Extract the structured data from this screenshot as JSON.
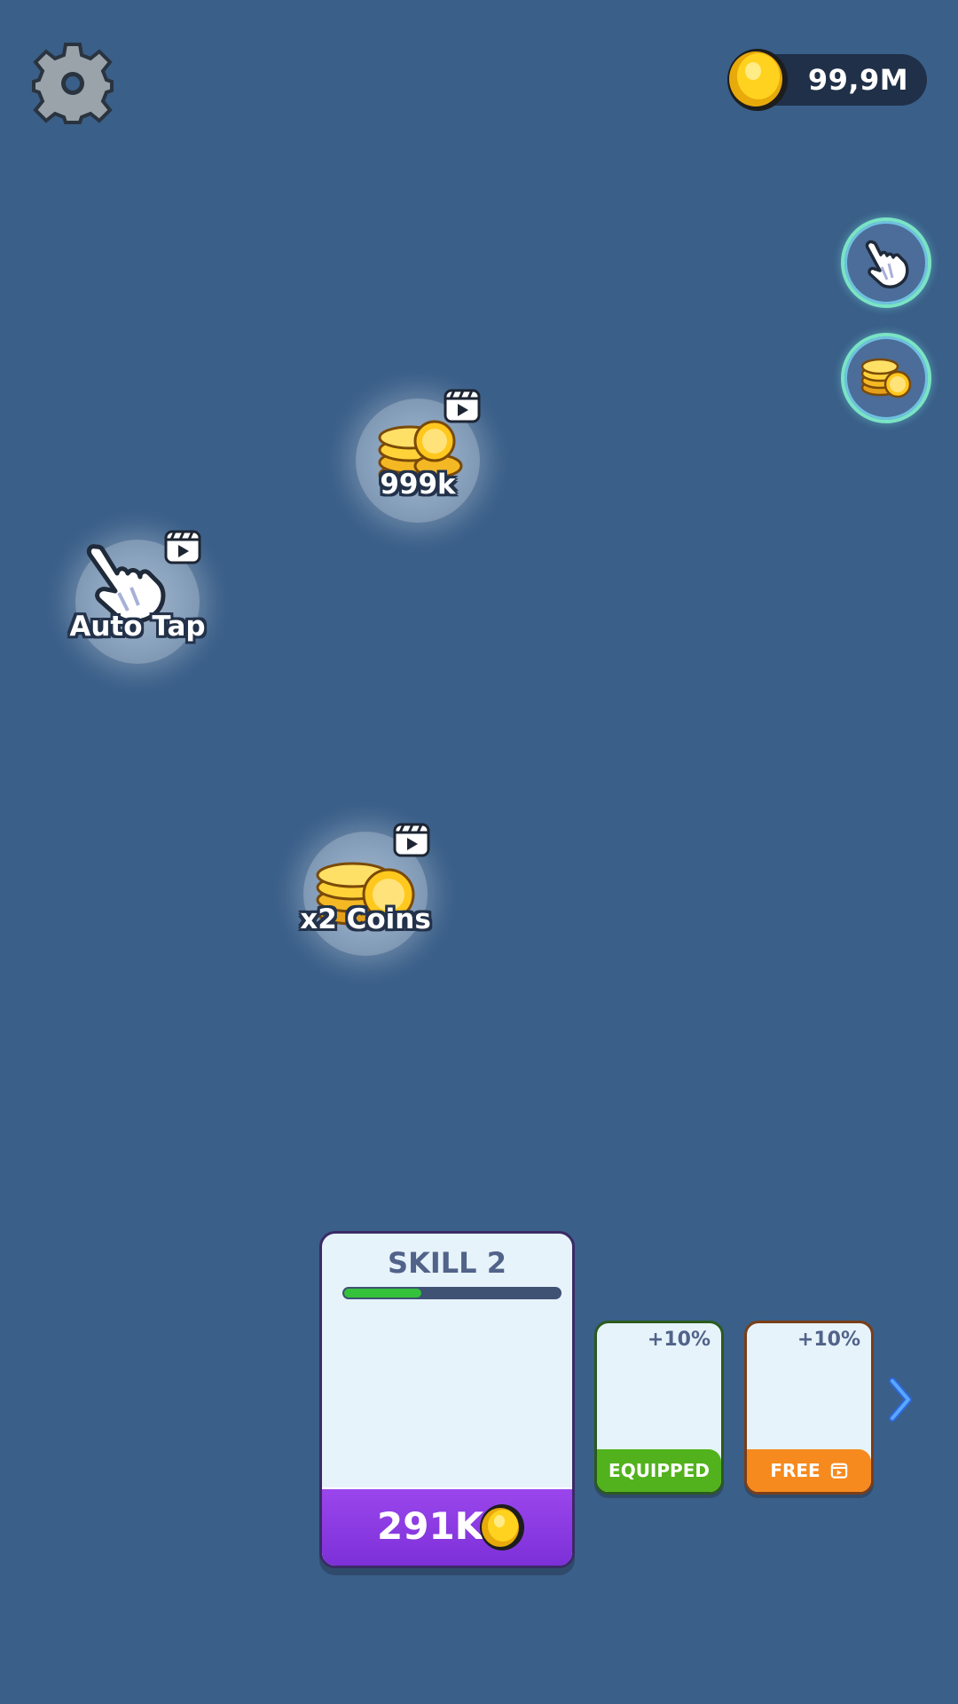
{
  "header": {
    "coins": "99,9M"
  },
  "side_buttons": [
    {
      "icon": "auto-tap-hand-icon"
    },
    {
      "icon": "coin-stack-icon"
    }
  ],
  "bubbles": [
    {
      "label": "999k",
      "icon": "coin-stack-icon"
    },
    {
      "label": "Auto Tap",
      "icon": "tapping-hand-icon"
    },
    {
      "label": "x2 Coins",
      "icon": "coin-stack-icon"
    }
  ],
  "skill_card": {
    "title": "SKILL 2",
    "progress": 0.36,
    "price": "291K"
  },
  "mini_cards": [
    {
      "bonus": "+10%",
      "footer": "EQUIPPED"
    },
    {
      "bonus": "+10%",
      "footer": "FREE"
    }
  ],
  "colors": {
    "background": "#3a5f89",
    "accent_purple": "#8a3ae2",
    "equipped_green": "#52b21d",
    "free_orange": "#f68a1e",
    "progress_green": "#34c23a"
  }
}
